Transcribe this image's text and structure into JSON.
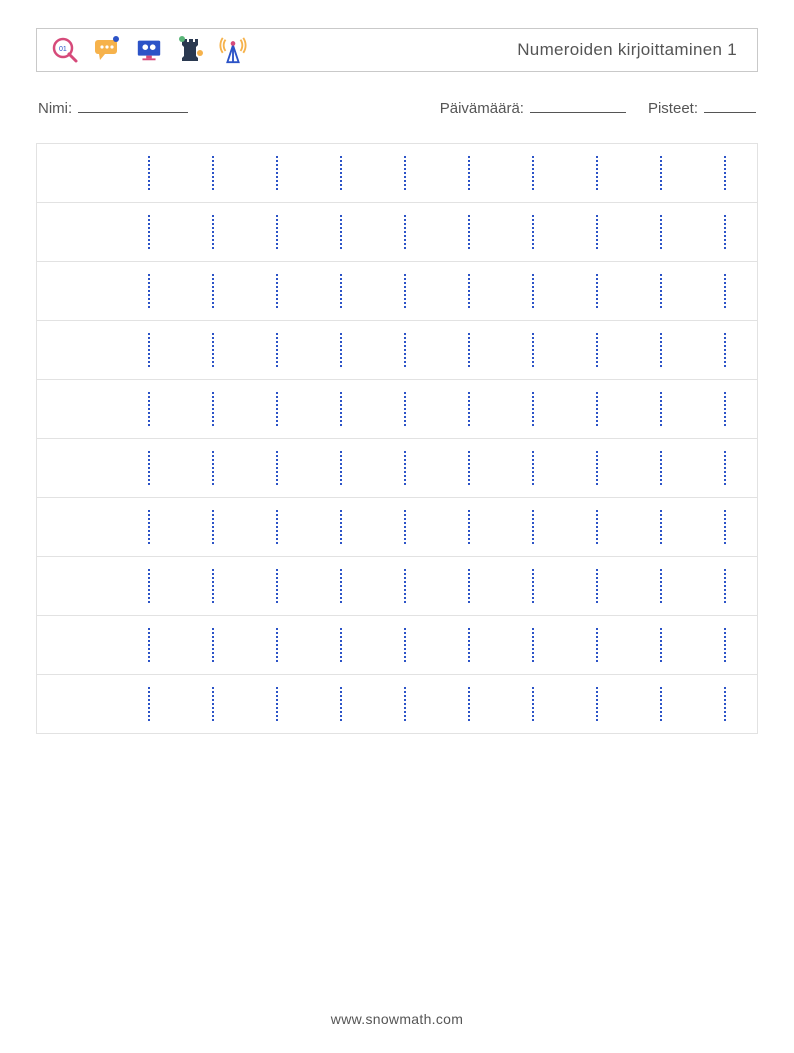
{
  "header": {
    "title": "Numeroiden kirjoittaminen 1",
    "icons": [
      "magnifier-icon",
      "speech-bubble-icon",
      "presentation-icon",
      "chess-rook-icon",
      "antenna-icon"
    ]
  },
  "info": {
    "name_label": "Nimi:",
    "date_label": "Päivämäärä:",
    "score_label": "Pisteet:"
  },
  "worksheet": {
    "rows": 10,
    "columns": 10,
    "digit": "1"
  },
  "footer": {
    "site": "www.snowmath.com"
  }
}
